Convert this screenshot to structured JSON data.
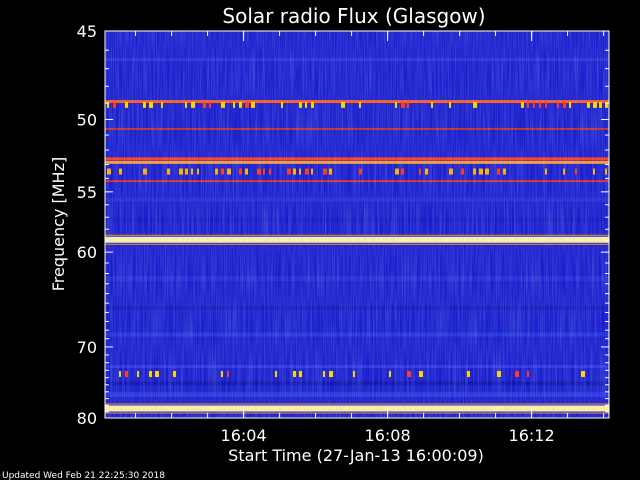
{
  "chart_data": {
    "type": "heatmap",
    "title": "Solar radio Flux (Glasgow)",
    "xlabel": "Start Time (27-Jan-13 16:00:09)",
    "ylabel": "Frequency [MHz]",
    "xlim": [
      "16:00:09",
      "16:14:09"
    ],
    "ylim": [
      45,
      80
    ],
    "y_scale": "reciprocal",
    "y_ticks": [
      {
        "value": 45,
        "label": "45"
      },
      {
        "value": 50,
        "label": "50"
      },
      {
        "value": 55,
        "label": "55"
      },
      {
        "value": 60,
        "label": "60"
      },
      {
        "value": 70,
        "label": "70"
      },
      {
        "value": 80,
        "label": "80"
      }
    ],
    "x_ticks": [
      {
        "value": "16:04",
        "label": "16:04"
      },
      {
        "value": "16:08",
        "label": "16:08"
      },
      {
        "value": "16:12",
        "label": "16:12"
      }
    ],
    "background_color": "#1a1ecc",
    "emission_bands": [
      {
        "freq": 48.9,
        "color": "#ff5a1a",
        "intensity": "high"
      },
      {
        "freq": 49.1,
        "color": "#ffd400",
        "intensity": "intermittent"
      },
      {
        "freq": 50.6,
        "color": "#c8321e",
        "intensity": "medium"
      },
      {
        "freq": 52.6,
        "color": "#ff3c1e",
        "intensity": "high"
      },
      {
        "freq": 52.85,
        "color": "#ff9a2a",
        "intensity": "high"
      },
      {
        "freq": 53.5,
        "color": "#ffb000",
        "intensity": "intermittent"
      },
      {
        "freq": 54.2,
        "color": "#e03020",
        "intensity": "medium"
      },
      {
        "freq": 58.9,
        "color": "#fff4a0",
        "intensity": "very-high"
      },
      {
        "freq": 73.5,
        "color": "#ffd400",
        "intensity": "intermittent"
      },
      {
        "freq": 78.5,
        "color": "#fff4a0",
        "intensity": "very-high"
      }
    ]
  },
  "footer": {
    "updated": "Updated Wed Feb 21 22:25:30 2018"
  }
}
